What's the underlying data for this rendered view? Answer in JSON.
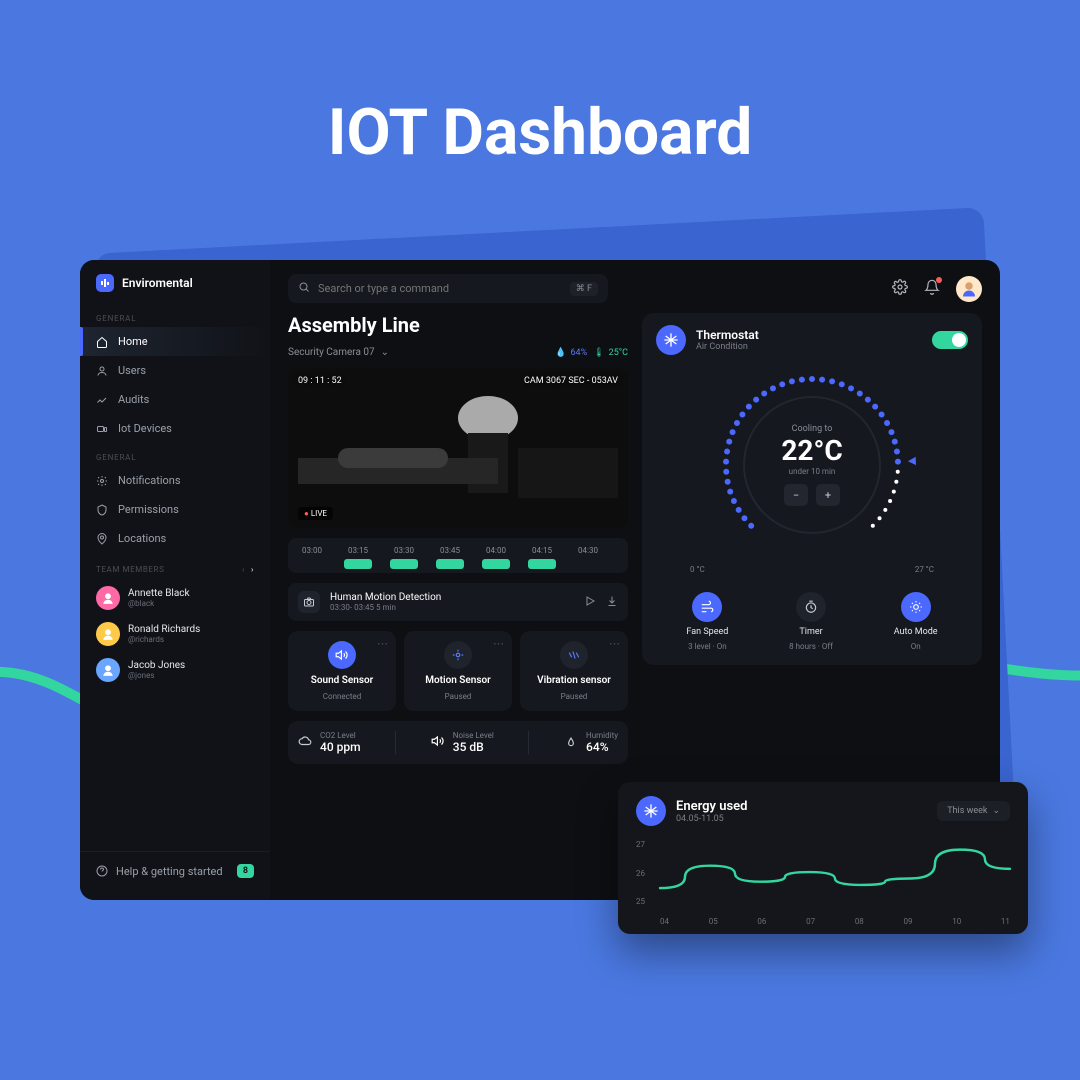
{
  "hero": "IOT Dashboard",
  "brand": "Enviromental",
  "sidebar": {
    "sections": [
      {
        "label": "GENERAL",
        "items": [
          "Home",
          "Users",
          "Audits",
          "Iot Devices"
        ]
      },
      {
        "label": "GENERAL",
        "items": [
          "Notifications",
          "Permissions",
          "Locations"
        ]
      }
    ],
    "team_label": "TEAM MEMBERS",
    "members": [
      {
        "name": "Annette Black",
        "handle": "@black",
        "color": "#ff6aa6"
      },
      {
        "name": "Ronald Richards",
        "handle": "@richards",
        "color": "#ffc94a"
      },
      {
        "name": "Jacob Jones",
        "handle": "@jones",
        "color": "#6aa6ff"
      }
    ],
    "help": "Help & getting started",
    "help_badge": "8"
  },
  "search": {
    "placeholder": "Search or type a command",
    "kbd": "⌘ F"
  },
  "page_title": "Assembly Line",
  "camera": {
    "name": "Security Camera 07",
    "humidity": "64%",
    "temp": "25°C",
    "time": "09 : 11 : 52",
    "id": "CAM 3067 SEC - 053AV",
    "live": "LIVE",
    "ticks": [
      "03:00",
      "03:15",
      "03:30",
      "03:45",
      "04:00",
      "04:15",
      "04:30"
    ],
    "clip": {
      "title": "Human Motion Detection",
      "sub": "03:30- 03:45    5 min"
    }
  },
  "sensors": [
    {
      "name": "Sound Sensor",
      "status": "Connected",
      "blue": true,
      "icon": "sound-icon"
    },
    {
      "name": "Motion Sensor",
      "status": "Paused",
      "blue": false,
      "icon": "target-icon"
    },
    {
      "name": "Vibration sensor",
      "status": "Paused",
      "blue": false,
      "icon": "vibration-icon"
    }
  ],
  "readouts": [
    {
      "label": "CO2 Level",
      "value": "40 ppm",
      "icon": "cloud-icon"
    },
    {
      "label": "Noise Level",
      "value": "35 dB",
      "icon": "sound-icon"
    },
    {
      "label": "Humidity",
      "value": "64%",
      "icon": "droplets-icon"
    }
  ],
  "thermo": {
    "title": "Thermostat",
    "sub": "Air Condition",
    "pre": "Cooling to",
    "temp": "22°C",
    "post": "under 10 min",
    "min": "0 °C",
    "max": "27 °C",
    "modes": [
      {
        "label": "Fan Speed",
        "sub": "3 level · On",
        "blue": true,
        "icon": "wind-icon"
      },
      {
        "label": "Timer",
        "sub": "8 hours · Off",
        "blue": false,
        "icon": "timer-icon"
      },
      {
        "label": "Auto Mode",
        "sub": "On",
        "blue": true,
        "icon": "sun-icon"
      }
    ]
  },
  "energy": {
    "title": "Energy used",
    "range": "04.05-11.05",
    "selector": "This week"
  },
  "chart_data": {
    "type": "line",
    "title": "Energy used",
    "x": [
      "04",
      "05",
      "06",
      "07",
      "08",
      "09",
      "10",
      "11"
    ],
    "values": [
      25.5,
      26.2,
      25.7,
      26.0,
      25.6,
      25.8,
      26.7,
      26.1
    ],
    "ylabel": "",
    "ylim": [
      25,
      27
    ]
  }
}
